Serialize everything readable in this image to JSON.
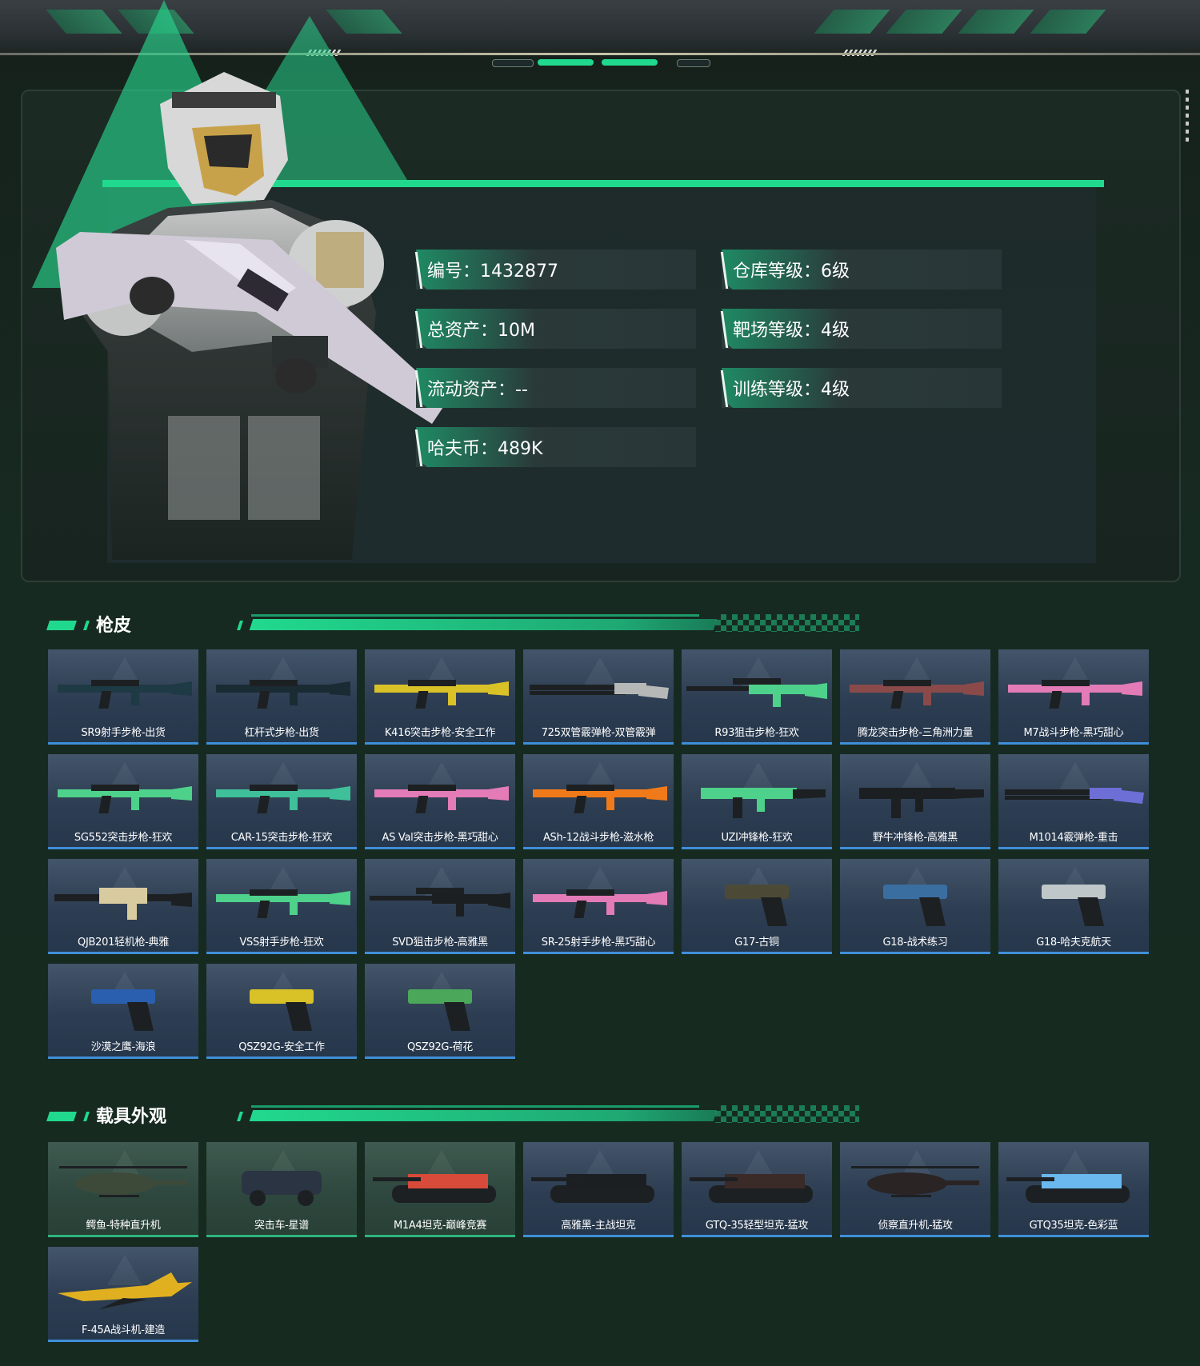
{
  "profile": {
    "stats": [
      {
        "label": "编号：1432877"
      },
      {
        "label": "仓库等级：6级"
      },
      {
        "label": "总资产：10M"
      },
      {
        "label": "靶场等级：4级"
      },
      {
        "label": "流动资产：--"
      },
      {
        "label": "训练等级：4级"
      },
      {
        "label": "哈夫币：489K"
      }
    ]
  },
  "sections": {
    "gun_skins": {
      "title": "枪皮",
      "items": [
        {
          "name": "SR9射手步枪-出货",
          "icon": "rifle-icon",
          "color": "#1e3a44"
        },
        {
          "name": "杠杆式步枪-出货",
          "icon": "rifle-icon",
          "color": "#1b2b34"
        },
        {
          "name": "K416突击步枪-安全工作",
          "icon": "rifle-icon",
          "color": "#d9c128"
        },
        {
          "name": "725双管霰弹枪-双管霰弹",
          "icon": "shotgun-icon",
          "color": "#b5b8b6"
        },
        {
          "name": "R93狙击步枪-狂欢",
          "icon": "sniper-icon",
          "color": "#4ed18a"
        },
        {
          "name": "腾龙突击步枪-三角洲力量",
          "icon": "rifle-icon",
          "color": "#8a4a4a"
        },
        {
          "name": "M7战斗步枪-黑巧甜心",
          "icon": "rifle-icon",
          "color": "#e27bb6"
        },
        {
          "name": "SG552突击步枪-狂欢",
          "icon": "rifle-icon",
          "color": "#4ed18a"
        },
        {
          "name": "CAR-15突击步枪-狂欢",
          "icon": "rifle-icon",
          "color": "#3fbf9a"
        },
        {
          "name": "AS Val突击步枪-黑巧甜心",
          "icon": "rifle-icon",
          "color": "#e27bb6"
        },
        {
          "name": "ASh-12战斗步枪-滋水枪",
          "icon": "rifle-icon",
          "color": "#f07a1a"
        },
        {
          "name": "UZI冲锋枪-狂欢",
          "icon": "smg-icon",
          "color": "#4ed18a"
        },
        {
          "name": "野牛冲锋枪-高雅黑",
          "icon": "smg-icon",
          "color": "#1c1f22"
        },
        {
          "name": "M1014霰弹枪-重击",
          "icon": "shotgun-icon",
          "color": "#6d6fd6"
        },
        {
          "name": "QJB201轻机枪-典雅",
          "icon": "lmg-icon",
          "color": "#d8cba0"
        },
        {
          "name": "VSS射手步枪-狂欢",
          "icon": "rifle-icon",
          "color": "#4ed18a"
        },
        {
          "name": "SVD狙击步枪-高雅黑",
          "icon": "sniper-icon",
          "color": "#1c1f22"
        },
        {
          "name": "SR-25射手步枪-黑巧甜心",
          "icon": "rifle-icon",
          "color": "#e27bb6"
        },
        {
          "name": "G17-古铜",
          "icon": "pistol-icon",
          "color": "#4c4a36"
        },
        {
          "name": "G18-战术练习",
          "icon": "pistol-icon",
          "color": "#3a6ea0"
        },
        {
          "name": "G18-哈夫克航天",
          "icon": "pistol-icon",
          "color": "#bfc7c9"
        },
        {
          "name": "沙漠之鹰-海浪",
          "icon": "pistol-icon",
          "color": "#2a5fb0"
        },
        {
          "name": "QSZ92G-安全工作",
          "icon": "pistol-icon",
          "color": "#d9c128"
        },
        {
          "name": "QSZ92G-荷花",
          "icon": "pistol-icon",
          "color": "#4ba85a"
        }
      ]
    },
    "vehicles": {
      "title": "载具外观",
      "items": [
        {
          "name": "鳄鱼-特种直升机",
          "icon": "helicopter-icon",
          "color": "#3d4a3a",
          "bg": "green"
        },
        {
          "name": "突击车-星谱",
          "icon": "car-icon",
          "color": "#2b3442",
          "bg": "green"
        },
        {
          "name": "M1A4坦克-巅峰竞赛",
          "icon": "tank-icon",
          "color": "#d84a3a",
          "bg": "green"
        },
        {
          "name": "高雅黑-主战坦克",
          "icon": "tank-icon",
          "color": "#1c1f22",
          "bg": "blue"
        },
        {
          "name": "GTQ-35轻型坦克-猛攻",
          "icon": "tank-icon",
          "color": "#3a2a28",
          "bg": "blue"
        },
        {
          "name": "侦察直升机-猛攻",
          "icon": "helicopter-icon",
          "color": "#2a2424",
          "bg": "blue"
        },
        {
          "name": "GTQ35坦克-色彩蓝",
          "icon": "tank-icon",
          "color": "#6ab8ee",
          "bg": "blue"
        },
        {
          "name": "F-45A战斗机-建造",
          "icon": "jet-icon",
          "color": "#e0b020",
          "bg": "blue"
        }
      ]
    }
  }
}
